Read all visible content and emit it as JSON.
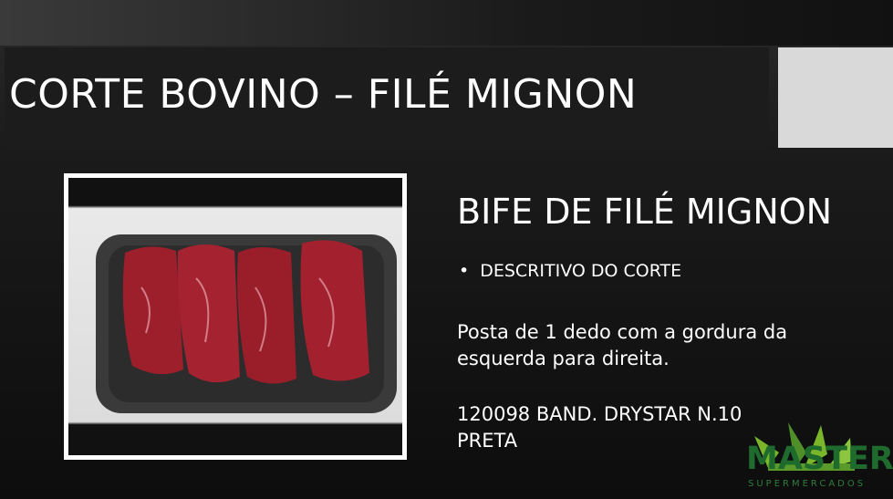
{
  "slide": {
    "title": "CORTE BOVINO – FILÉ MIGNON",
    "product_heading": "BIFE DE FILÉ MIGNON",
    "bullet": "DESCRITIVO DO CORTE",
    "description": "Posta de 1 dedo com a gordura da esquerda para direita.",
    "packaging": "120098 BAND. DRYSTAR N.10 PRETA"
  },
  "logo": {
    "name": "MASTER",
    "subtitle": "SUPERMERCADOS",
    "colors": {
      "primary": "#1f6b2e",
      "leaf_light": "#7ab52a"
    }
  },
  "photo": {
    "icon": "beef-steaks-photo"
  }
}
